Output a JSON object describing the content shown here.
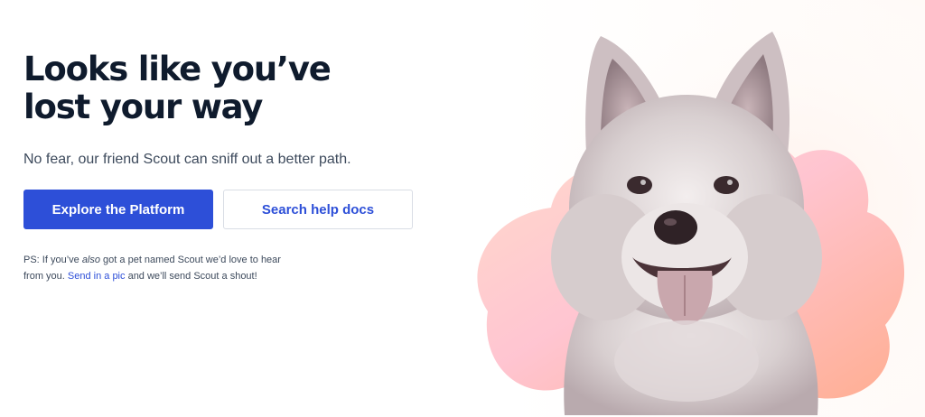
{
  "hero": {
    "headline_line1": "Looks like you’ve",
    "headline_line2": "lost your way",
    "subtitle": "No fear, our friend Scout can sniff out a better path."
  },
  "actions": {
    "primary_label": "Explore the Platform",
    "secondary_label": "Search help docs"
  },
  "ps": {
    "part1": "PS: If you’ve ",
    "emphasis": "also",
    "part2": " got a pet named Scout we’d love to hear from you. ",
    "link_label": "Send in a pic",
    "part3": " and we’ll send Scout a shout!"
  },
  "illustration": {
    "subject": "dog-photo",
    "blob_color_light": "#ffd9c8",
    "blob_color_mid": "#ffb09a",
    "blob_color_pink": "#ffc2cf"
  },
  "colors": {
    "accent": "#2d4fd8",
    "heading": "#0f1b2d",
    "body_text": "#3d4a5c"
  }
}
